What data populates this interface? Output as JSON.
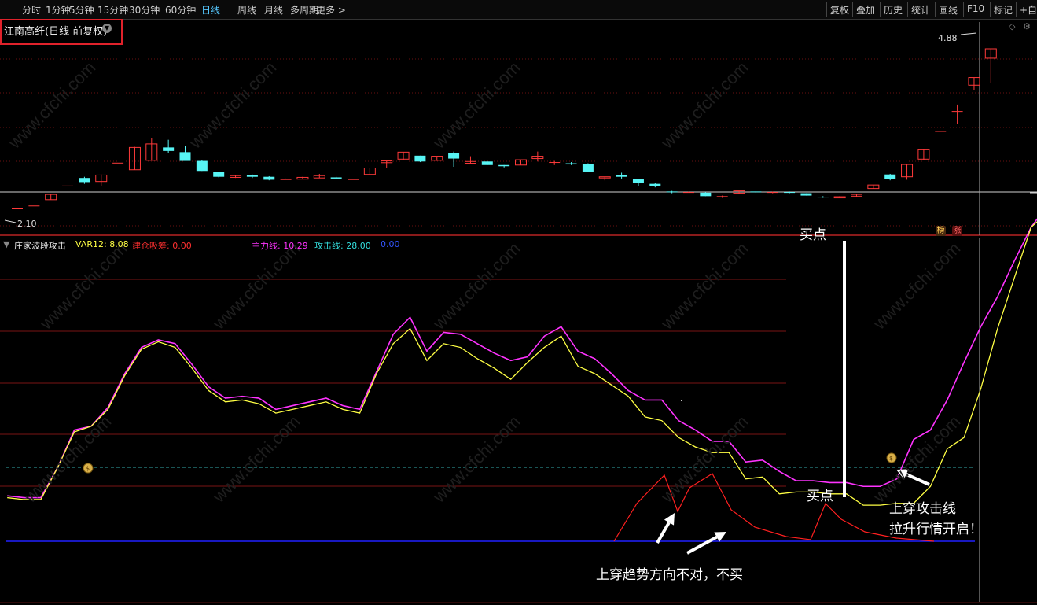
{
  "toolbar": {
    "periods": [
      "分时",
      "1分钟",
      "5分钟",
      "15分钟",
      "30分钟",
      "60分钟",
      "日线",
      "周线",
      "月线",
      "多周期",
      "更多 >"
    ],
    "active_period": "日线",
    "right_buttons": [
      "复权",
      "叠加",
      "历史",
      "统计",
      "画线",
      "F10",
      "标记",
      "+自"
    ]
  },
  "stock": {
    "title": "江南高纤(日线 前复权)"
  },
  "price_panel": {
    "high_label": "4.88",
    "low_label": "2.10",
    "tags": [
      "榜",
      "涨"
    ]
  },
  "indicator": {
    "name": "庄家波段攻击",
    "var12": "VAR12: 8.08",
    "build": "建仓吸筹: 0.00",
    "main": "主力线: 10.29",
    "attack": "攻击线: 28.00",
    "extra": "0.00"
  },
  "annotations": {
    "buy1": "买点",
    "buy2": "买点",
    "cross_text_1": "上穿攻击线",
    "cross_text_2": "拉升行情开启！",
    "wrong_text": "上穿趋势方向不对，不买"
  },
  "colors": {
    "up": "#ff3a3a",
    "down": "#57f5f5",
    "main_line": "#ff33ff",
    "attack_line": "#ffff44",
    "build_line": "#ff2020",
    "base_line": "#2020ff",
    "cyan_dash": "#33aaaa"
  },
  "chart_data": [
    {
      "type": "candlestick",
      "title": "江南高纤(日线 前复权)",
      "price_labels": {
        "high": 4.88,
        "low": 2.1
      },
      "candles": [
        {
          "o": 2.16,
          "c": 2.16,
          "h": 2.16,
          "l": 2.16
        },
        {
          "o": 2.21,
          "c": 2.21,
          "h": 2.21,
          "l": 2.21
        },
        {
          "o": 2.31,
          "c": 2.4,
          "h": 2.4,
          "l": 2.31
        },
        {
          "o": 2.55,
          "c": 2.55,
          "h": 2.55,
          "l": 2.55
        },
        {
          "o": 2.68,
          "c": 2.61,
          "h": 2.7,
          "l": 2.58
        },
        {
          "o": 2.62,
          "c": 2.73,
          "h": 2.74,
          "l": 2.55
        },
        {
          "o": 2.94,
          "c": 2.94,
          "h": 2.94,
          "l": 2.94
        },
        {
          "o": 2.82,
          "c": 3.2,
          "h": 3.21,
          "l": 2.82
        },
        {
          "o": 2.98,
          "c": 3.26,
          "h": 3.36,
          "l": 2.98
        },
        {
          "o": 3.2,
          "c": 3.14,
          "h": 3.33,
          "l": 3.1
        },
        {
          "o": 3.12,
          "c": 2.97,
          "h": 3.22,
          "l": 2.97
        },
        {
          "o": 2.97,
          "c": 2.8,
          "h": 2.99,
          "l": 2.8
        },
        {
          "o": 2.78,
          "c": 2.7,
          "h": 2.78,
          "l": 2.69
        },
        {
          "o": 2.69,
          "c": 2.72,
          "h": 2.73,
          "l": 2.68
        },
        {
          "o": 2.73,
          "c": 2.7,
          "h": 2.74,
          "l": 2.68
        },
        {
          "o": 2.7,
          "c": 2.65,
          "h": 2.71,
          "l": 2.64
        },
        {
          "o": 2.66,
          "c": 2.66,
          "h": 2.67,
          "l": 2.65
        },
        {
          "o": 2.66,
          "c": 2.69,
          "h": 2.7,
          "l": 2.66
        },
        {
          "o": 2.68,
          "c": 2.72,
          "h": 2.75,
          "l": 2.68
        },
        {
          "o": 2.69,
          "c": 2.67,
          "h": 2.7,
          "l": 2.66
        },
        {
          "o": 2.66,
          "c": 2.66,
          "h": 2.66,
          "l": 2.65
        },
        {
          "o": 2.74,
          "c": 2.85,
          "h": 2.85,
          "l": 2.74
        },
        {
          "o": 2.94,
          "c": 2.97,
          "h": 2.97,
          "l": 2.85
        },
        {
          "o": 3.0,
          "c": 3.12,
          "h": 3.12,
          "l": 2.99
        },
        {
          "o": 3.06,
          "c": 2.96,
          "h": 3.06,
          "l": 2.95
        },
        {
          "o": 2.98,
          "c": 3.05,
          "h": 3.05,
          "l": 2.97
        },
        {
          "o": 3.1,
          "c": 3.01,
          "h": 3.13,
          "l": 2.87
        },
        {
          "o": 2.93,
          "c": 2.96,
          "h": 3.05,
          "l": 2.93
        },
        {
          "o": 2.96,
          "c": 2.9,
          "h": 2.96,
          "l": 2.9
        },
        {
          "o": 2.9,
          "c": 2.88,
          "h": 2.9,
          "l": 2.86
        },
        {
          "o": 2.9,
          "c": 2.99,
          "h": 2.99,
          "l": 2.9
        },
        {
          "o": 3.01,
          "c": 3.05,
          "h": 3.13,
          "l": 2.96
        },
        {
          "o": 2.95,
          "c": 2.95,
          "h": 2.97,
          "l": 2.9
        },
        {
          "o": 2.93,
          "c": 2.91,
          "h": 2.95,
          "l": 2.9
        },
        {
          "o": 2.92,
          "c": 2.79,
          "h": 2.93,
          "l": 2.79
        },
        {
          "o": 2.68,
          "c": 2.7,
          "h": 2.7,
          "l": 2.64
        },
        {
          "o": 2.73,
          "c": 2.7,
          "h": 2.77,
          "l": 2.67
        },
        {
          "o": 2.66,
          "c": 2.6,
          "h": 2.66,
          "l": 2.54
        },
        {
          "o": 2.58,
          "c": 2.54,
          "h": 2.6,
          "l": 2.52
        },
        {
          "o": 2.45,
          "c": 2.44,
          "h": 2.46,
          "l": 2.42
        },
        {
          "o": 2.44,
          "c": 2.44,
          "h": 2.45,
          "l": 2.43
        },
        {
          "o": 2.43,
          "c": 2.37,
          "h": 2.44,
          "l": 2.37
        },
        {
          "o": 2.37,
          "c": 2.37,
          "h": 2.38,
          "l": 2.34
        },
        {
          "o": 2.42,
          "c": 2.46,
          "h": 2.46,
          "l": 2.41
        },
        {
          "o": 2.45,
          "c": 2.44,
          "h": 2.45,
          "l": 2.43
        },
        {
          "o": 2.44,
          "c": 2.44,
          "h": 2.45,
          "l": 2.42
        },
        {
          "o": 2.44,
          "c": 2.43,
          "h": 2.45,
          "l": 2.42
        },
        {
          "o": 2.42,
          "c": 2.38,
          "h": 2.42,
          "l": 2.38
        },
        {
          "o": 2.36,
          "c": 2.35,
          "h": 2.37,
          "l": 2.34
        },
        {
          "o": 2.34,
          "c": 2.36,
          "h": 2.37,
          "l": 2.34
        },
        {
          "o": 2.37,
          "c": 2.4,
          "h": 2.4,
          "l": 2.35
        },
        {
          "o": 2.5,
          "c": 2.56,
          "h": 2.56,
          "l": 2.5
        },
        {
          "o": 2.74,
          "c": 2.66,
          "h": 2.75,
          "l": 2.64
        },
        {
          "o": 2.7,
          "c": 2.91,
          "h": 2.91,
          "l": 2.65
        },
        {
          "o": 3.0,
          "c": 3.16,
          "h": 3.16,
          "l": 2.98
        },
        {
          "o": 3.48,
          "c": 3.48,
          "h": 3.48,
          "l": 3.48
        },
        {
          "o": 3.82,
          "c": 3.82,
          "h": 3.93,
          "l": 3.6
        },
        {
          "o": 4.26,
          "c": 4.39,
          "h": 4.39,
          "l": 4.17
        },
        {
          "o": 4.72,
          "c": 4.88,
          "h": 4.88,
          "l": 4.3
        }
      ]
    },
    {
      "type": "line",
      "title": "庄家波段攻击",
      "series": [
        {
          "name": "主力线",
          "values": [
            15,
            14,
            14,
            30,
            50,
            52,
            62,
            80,
            94,
            98,
            96,
            85,
            73,
            67,
            68,
            67,
            61,
            63,
            65,
            67,
            63,
            61,
            81,
            101,
            110,
            92,
            102,
            101,
            96,
            91,
            87,
            89,
            100,
            105,
            92,
            88,
            80,
            71,
            66,
            66,
            55,
            50,
            44,
            44,
            33,
            34,
            28,
            23,
            23,
            22,
            22,
            20,
            20,
            24,
            45,
            50,
            66,
            86,
            105,
            121,
            140,
            158,
            170,
            172
          ]
        },
        {
          "name": "攻击线",
          "values": [
            14,
            13,
            13,
            30,
            49,
            52,
            61,
            79,
            93,
            97,
            94,
            83,
            71,
            65,
            66,
            64,
            59,
            61,
            63,
            65,
            61,
            59,
            80,
            96,
            104,
            87,
            96,
            94,
            88,
            83,
            77,
            86,
            94,
            100,
            84,
            80,
            74,
            68,
            57,
            55,
            46,
            41,
            38,
            38,
            24,
            25,
            16,
            17,
            17,
            16,
            16,
            10,
            10,
            11,
            11,
            20,
            40,
            46,
            72,
            104,
            131,
            158,
            166,
            166
          ]
        },
        {
          "name": "建仓吸筹",
          "values": [
            0,
            0,
            0,
            0,
            0,
            0,
            0,
            0,
            0,
            0,
            0,
            0,
            0,
            0,
            0,
            0,
            0,
            0,
            0,
            0,
            0,
            0,
            0,
            0,
            0,
            0,
            0,
            0,
            0,
            0,
            0,
            0,
            0,
            0,
            0,
            0,
            0,
            0,
            0,
            0,
            0,
            0,
            0,
            0,
            0,
            0,
            0,
            0,
            0,
            0,
            0,
            0,
            0,
            0,
            0,
            0,
            0,
            0,
            0,
            0,
            0,
            0,
            0,
            0
          ]
        }
      ]
    }
  ]
}
